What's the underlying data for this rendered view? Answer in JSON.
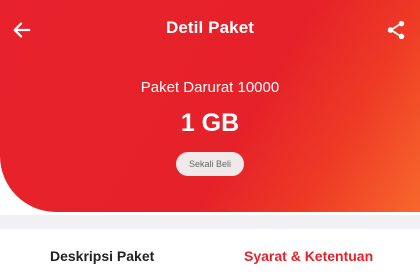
{
  "header": {
    "title": "Detil Paket",
    "back_icon": "arrow-left-icon",
    "share_icon": "share-icon"
  },
  "package": {
    "name": "Paket Darurat 10000",
    "quota": "1 GB",
    "purchase_type": "Sekali Beli"
  },
  "tabs": [
    {
      "label": "Deskripsi Paket",
      "active": false
    },
    {
      "label": "Syarat & Ketentuan",
      "active": true
    }
  ],
  "colors": {
    "brand_red": "#e52129",
    "brand_orange": "#f7682d",
    "badge_bg": "#f1e9e9",
    "divider": "#f1f1f3"
  }
}
